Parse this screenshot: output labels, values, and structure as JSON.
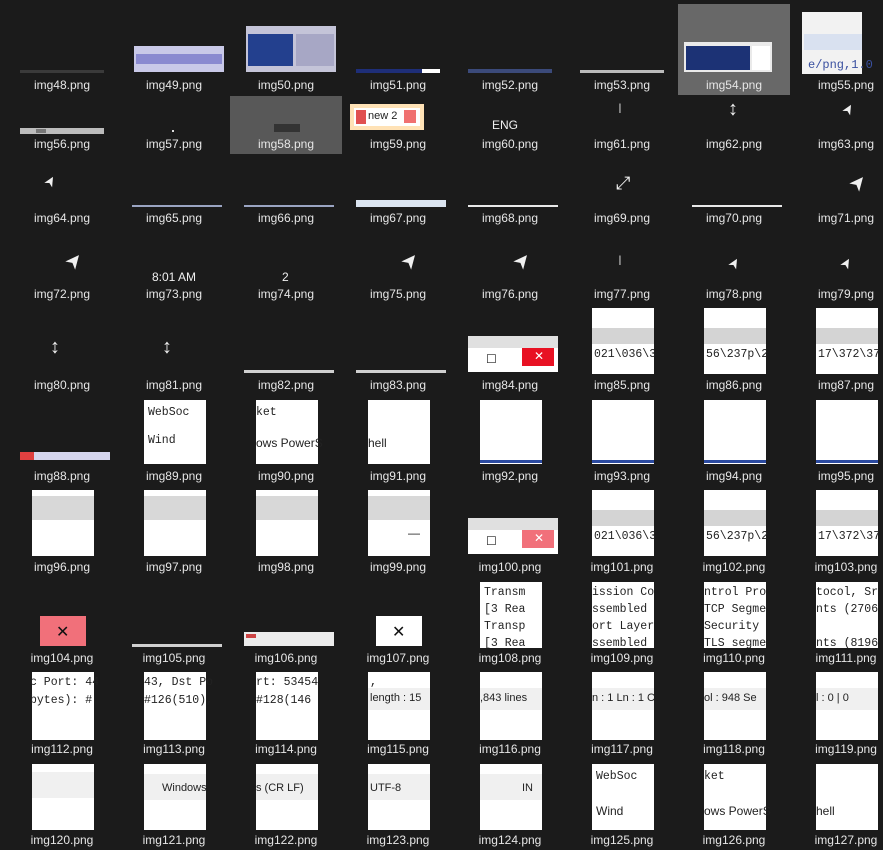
{
  "tiles": [
    {
      "n": "img48.png"
    },
    {
      "n": "img49.png"
    },
    {
      "n": "img50.png"
    },
    {
      "n": "img51.png"
    },
    {
      "n": "img52.png"
    },
    {
      "n": "img53.png"
    },
    {
      "n": "img54.png",
      "selected": true
    },
    {
      "n": "img55.png"
    },
    {
      "n": "img56.png"
    },
    {
      "n": "img57.png"
    },
    {
      "n": "img58.png"
    },
    {
      "n": "img59.png"
    },
    {
      "n": "img60.png"
    },
    {
      "n": "img61.png"
    },
    {
      "n": "img62.png"
    },
    {
      "n": "img63.png"
    },
    {
      "n": "img64.png"
    },
    {
      "n": "img65.png"
    },
    {
      "n": "img66.png"
    },
    {
      "n": "img67.png"
    },
    {
      "n": "img68.png"
    },
    {
      "n": "img69.png"
    },
    {
      "n": "img70.png"
    },
    {
      "n": "img71.png"
    },
    {
      "n": "img72.png"
    },
    {
      "n": "img73.png"
    },
    {
      "n": "img74.png"
    },
    {
      "n": "img75.png"
    },
    {
      "n": "img76.png"
    },
    {
      "n": "img77.png"
    },
    {
      "n": "img78.png"
    },
    {
      "n": "img79.png"
    },
    {
      "n": "img80.png"
    },
    {
      "n": "img81.png"
    },
    {
      "n": "img82.png"
    },
    {
      "n": "img83.png"
    },
    {
      "n": "img84.png"
    },
    {
      "n": "img85.png"
    },
    {
      "n": "img86.png"
    },
    {
      "n": "img87.png"
    },
    {
      "n": "img88.png"
    },
    {
      "n": "img89.png"
    },
    {
      "n": "img90.png"
    },
    {
      "n": "img91.png"
    },
    {
      "n": "img92.png"
    },
    {
      "n": "img93.png"
    },
    {
      "n": "img94.png"
    },
    {
      "n": "img95.png"
    },
    {
      "n": "img96.png"
    },
    {
      "n": "img97.png"
    },
    {
      "n": "img98.png"
    },
    {
      "n": "img99.png"
    },
    {
      "n": "img100.png"
    },
    {
      "n": "img101.png"
    },
    {
      "n": "img102.png"
    },
    {
      "n": "img103.png"
    },
    {
      "n": "img104.png"
    },
    {
      "n": "img105.png"
    },
    {
      "n": "img106.png"
    },
    {
      "n": "img107.png"
    },
    {
      "n": "img108.png"
    },
    {
      "n": "img109.png"
    },
    {
      "n": "img110.png"
    },
    {
      "n": "img111.png"
    },
    {
      "n": "img112.png"
    },
    {
      "n": "img113.png"
    },
    {
      "n": "img114.png"
    },
    {
      "n": "img115.png"
    },
    {
      "n": "img116.png"
    },
    {
      "n": "img117.png"
    },
    {
      "n": "img118.png"
    },
    {
      "n": "img119.png"
    },
    {
      "n": "img120.png"
    },
    {
      "n": "img121.png"
    },
    {
      "n": "img122.png"
    },
    {
      "n": "img123.png"
    },
    {
      "n": "img124.png"
    },
    {
      "n": "img125.png"
    },
    {
      "n": "img126.png"
    },
    {
      "n": "img127.png"
    }
  ],
  "thumb_text": {
    "new2": "new 2",
    "eng": "ENG",
    "time": "8:01 AM",
    "two": "2",
    "oct_85": "021\\036\\3",
    "oct_86": "56\\237p\\2",
    "oct_87": "17\\372\\37",
    "ws_websocket": "WebSoc",
    "ws_ket": "ket",
    "ws_windows": "Windows PowerShell",
    "ws_wind": "Wind",
    "ws_ows": "ows PowerS",
    "ws_hell": "hell",
    "tree_1": "Transm",
    "tree_2": "[3 Rea",
    "tree_3": "Transp",
    "tree_4": "[3 Rea",
    "tree_109a": "ission Co",
    "tree_109b": "ssembled",
    "tree_109c": "ort Layer",
    "tree_109d": "ssembled",
    "tree_110a": "ntrol Pro",
    "tree_110b": "TCP Segme",
    "tree_110c": " Security",
    "tree_110d": "TLS segme",
    "tree_111a": "tocol, Sr",
    "tree_111b": "nts (2706",
    "tree_111c": "",
    "tree_111d": "nts (8196",
    "pkt_112a": "c Port: 44",
    "pkt_112b": " bytes): #",
    "pkt_113a": "43, Dst Po",
    "pkt_113b": "#126(510),",
    "pkt_114a": "rt: 53454",
    "pkt_114b": " #128(146",
    "pkt_115": ",",
    "status_115": "length : 15",
    "status_116": ",843    lines",
    "status_117": "n : 1 Ln : 1    C",
    "status_118": "ol : 948    Se",
    "status_119": "l : 0 | 0",
    "bottom_121": "Windows",
    "bottom_122": "s (CR LF)",
    "bottom_123": "UTF-8",
    "bottom_124": "IN",
    "close_glyph": "✕",
    "dash_glyph": "—",
    "sq_glyph": "☐"
  },
  "colors": {
    "background": "#1b1b1b",
    "selected": "#686868",
    "label": "#e6e6e6",
    "close_red": "#e81123",
    "close_pink": "#f1707a"
  }
}
